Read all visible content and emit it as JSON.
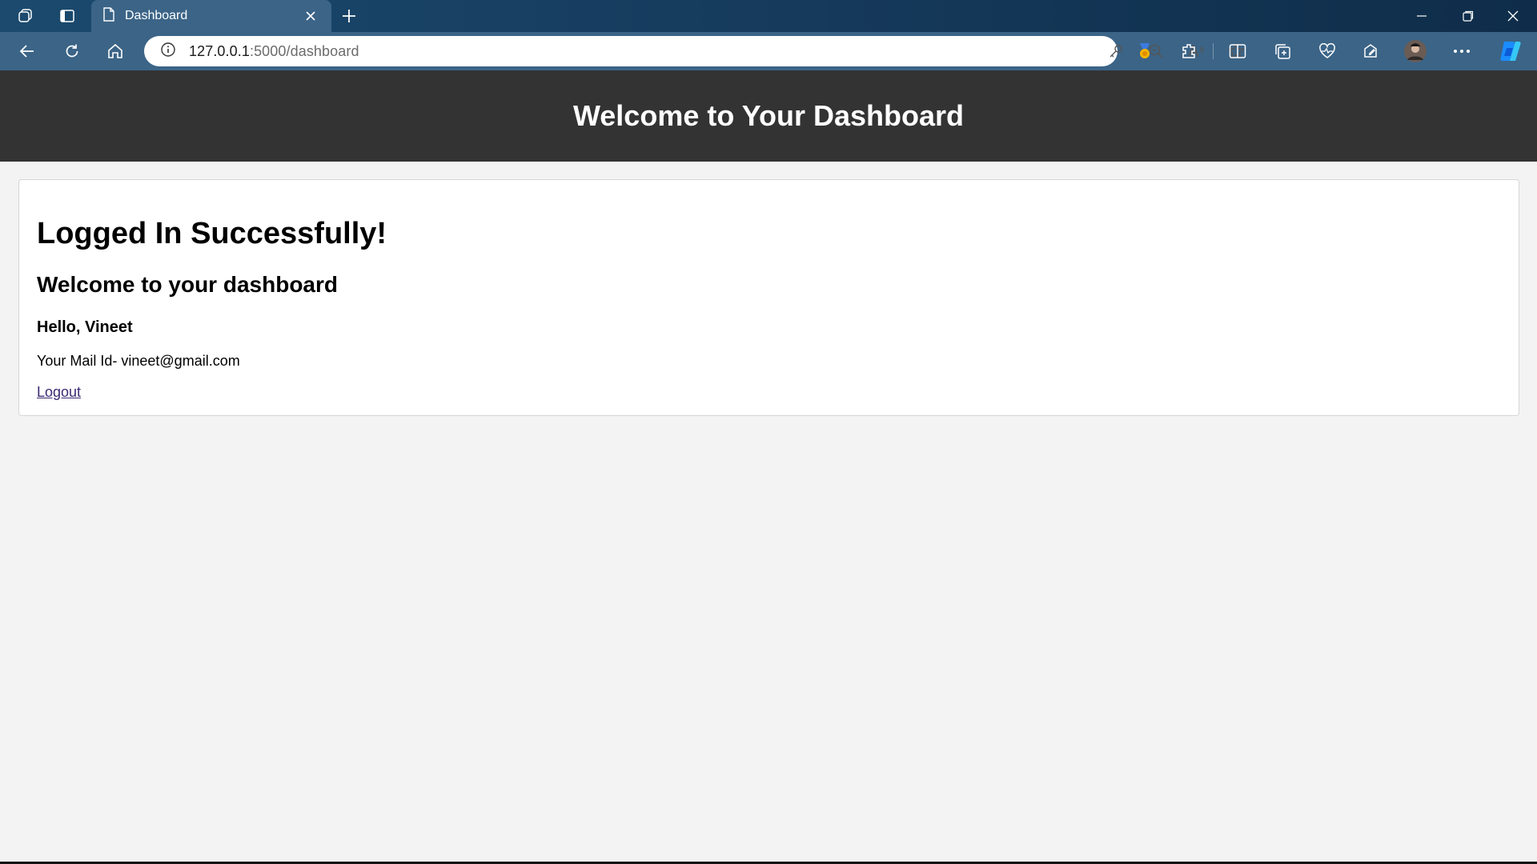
{
  "browser": {
    "tab_title": "Dashboard",
    "url_host": "127.0.0.1",
    "url_path": ":5000/dashboard"
  },
  "page": {
    "header_title": "Welcome to Your Dashboard",
    "status_heading": "Logged In Successfully!",
    "welcome_heading": "Welcome to your dashboard",
    "greeting": "Hello, Vineet",
    "mail_text": "Your Mail Id- vineet@gmail.com",
    "logout_link": "Logout"
  },
  "colors": {
    "header_bg": "#333333",
    "page_bg": "#f3f3f3",
    "browser_toolbar": "#3b6487",
    "link": "#3b2a73"
  }
}
